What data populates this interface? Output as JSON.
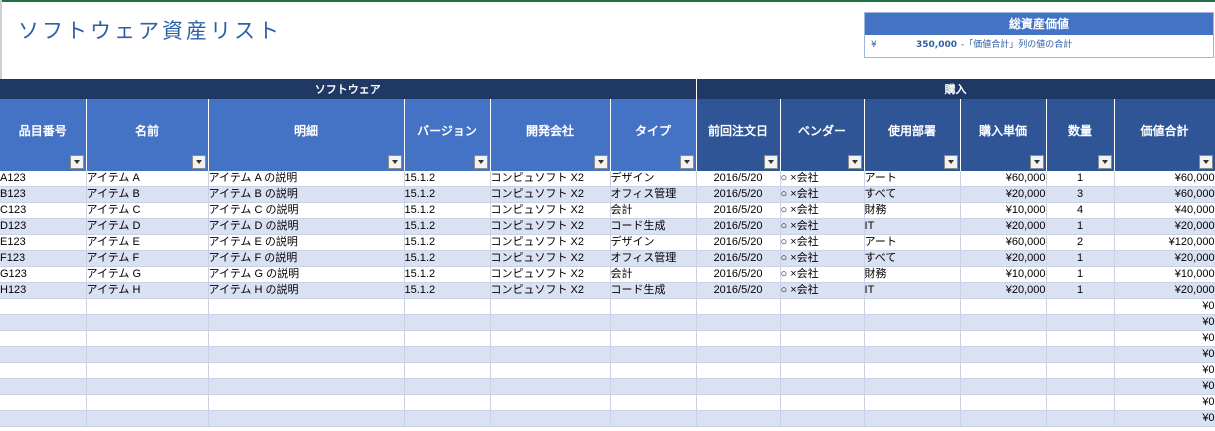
{
  "title": "ソフトウェア資産リスト",
  "summary": {
    "heading": "総資産価値",
    "currency": "¥",
    "amount": "350,000",
    "note": "-「価値合計」列の値の合計"
  },
  "groups": {
    "software": "ソフトウェア",
    "purchase": "購入"
  },
  "columns": [
    "品目番号",
    "名前",
    "明細",
    "バージョン",
    "開発会社",
    "タイプ",
    "前回注文日",
    "ベンダー",
    "使用部署",
    "購入単価",
    "数量",
    "価値合計"
  ],
  "rows": [
    [
      "A123",
      "アイテム A",
      "アイテム A の説明",
      "15.1.2",
      "コンピュソフト X2",
      "デザイン",
      "2016/5/20",
      "○ ×会社",
      "アート",
      "¥60,000",
      "1",
      "¥60,000"
    ],
    [
      "B123",
      "アイテム B",
      "アイテム B の説明",
      "15.1.2",
      "コンピュソフト X2",
      "オフィス管理",
      "2016/5/20",
      "○ ×会社",
      "すべて",
      "¥20,000",
      "3",
      "¥60,000"
    ],
    [
      "C123",
      "アイテム C",
      "アイテム C の説明",
      "15.1.2",
      "コンピュソフト X2",
      "会計",
      "2016/5/20",
      "○ ×会社",
      "財務",
      "¥10,000",
      "4",
      "¥40,000"
    ],
    [
      "D123",
      "アイテム D",
      "アイテム D の説明",
      "15.1.2",
      "コンピュソフト X2",
      "コード生成",
      "2016/5/20",
      "○ ×会社",
      "IT",
      "¥20,000",
      "1",
      "¥20,000"
    ],
    [
      "E123",
      "アイテム E",
      "アイテム E の説明",
      "15.1.2",
      "コンピュソフト X2",
      "デザイン",
      "2016/5/20",
      "○ ×会社",
      "アート",
      "¥60,000",
      "2",
      "¥120,000"
    ],
    [
      "F123",
      "アイテム F",
      "アイテム F の説明",
      "15.1.2",
      "コンピュソフト X2",
      "オフィス管理",
      "2016/5/20",
      "○ ×会社",
      "すべて",
      "¥20,000",
      "1",
      "¥20,000"
    ],
    [
      "G123",
      "アイテム G",
      "アイテム G の説明",
      "15.1.2",
      "コンピュソフト X2",
      "会計",
      "2016/5/20",
      "○ ×会社",
      "財務",
      "¥10,000",
      "1",
      "¥10,000"
    ],
    [
      "H123",
      "アイテム H",
      "アイテム H の説明",
      "15.1.2",
      "コンピュソフト X2",
      "コード生成",
      "2016/5/20",
      "○ ×会社",
      "IT",
      "¥20,000",
      "1",
      "¥20,000"
    ],
    [
      "",
      "",
      "",
      "",
      "",
      "",
      "",
      "",
      "",
      "",
      "",
      "¥0"
    ],
    [
      "",
      "",
      "",
      "",
      "",
      "",
      "",
      "",
      "",
      "",
      "",
      "¥0"
    ],
    [
      "",
      "",
      "",
      "",
      "",
      "",
      "",
      "",
      "",
      "",
      "",
      "¥0"
    ],
    [
      "",
      "",
      "",
      "",
      "",
      "",
      "",
      "",
      "",
      "",
      "",
      "¥0"
    ],
    [
      "",
      "",
      "",
      "",
      "",
      "",
      "",
      "",
      "",
      "",
      "",
      "¥0"
    ],
    [
      "",
      "",
      "",
      "",
      "",
      "",
      "",
      "",
      "",
      "",
      "",
      "¥0"
    ],
    [
      "",
      "",
      "",
      "",
      "",
      "",
      "",
      "",
      "",
      "",
      "",
      "¥0"
    ],
    [
      "",
      "",
      "",
      "",
      "",
      "",
      "",
      "",
      "",
      "",
      "",
      "¥0"
    ]
  ]
}
